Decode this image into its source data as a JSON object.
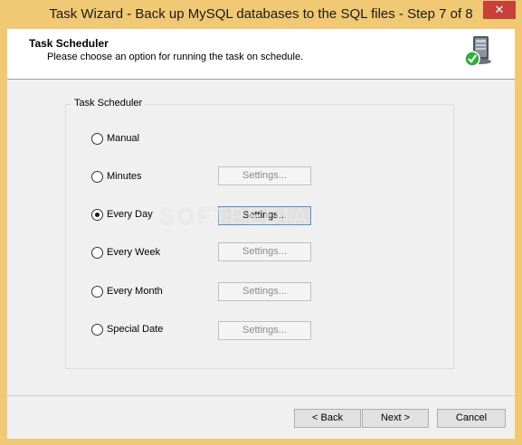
{
  "window": {
    "title": "Task Wizard - Back up MySQL databases to the SQL files - Step 7 of 8",
    "close_glyph": "✕"
  },
  "header": {
    "title": "Task Scheduler",
    "subtitle": "Please choose an option for running the task on schedule.",
    "icon": "computer-check-icon"
  },
  "group": {
    "legend": "Task Scheduler"
  },
  "options": [
    {
      "label": "Manual",
      "checked": false,
      "has_settings": false
    },
    {
      "label": "Minutes",
      "checked": false,
      "has_settings": true,
      "settings_enabled": false
    },
    {
      "label": "Every Day",
      "checked": true,
      "has_settings": true,
      "settings_enabled": true
    },
    {
      "label": "Every Week",
      "checked": false,
      "has_settings": true,
      "settings_enabled": false
    },
    {
      "label": "Every Month",
      "checked": false,
      "has_settings": true,
      "settings_enabled": false
    },
    {
      "label": "Special Date",
      "checked": false,
      "has_settings": true,
      "settings_enabled": false
    }
  ],
  "settings_label": "Settings...",
  "buttons": {
    "back": "< Back",
    "next": "Next >",
    "cancel": "Cancel"
  },
  "watermark": "SOFTPEDIA",
  "colors": {
    "title_bar": "#f1c873",
    "close_button": "#c7403a",
    "focus_border": "#4a8fd8"
  }
}
